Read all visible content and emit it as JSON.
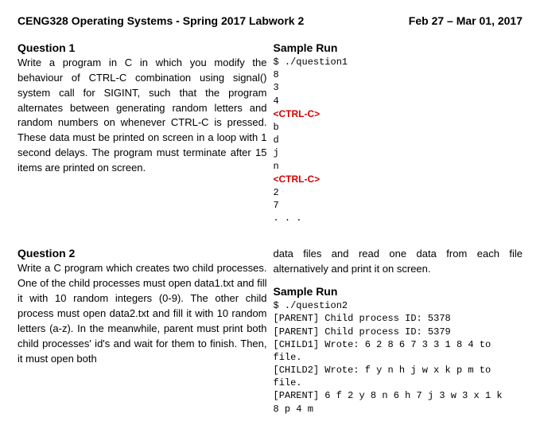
{
  "header": {
    "title": "CENG328 Operating Systems - Spring 2017 Labwork 2",
    "date": "Feb 27 – Mar 01, 2017"
  },
  "q1": {
    "title": "Question 1",
    "text": "Write a program in C in which you modify the behaviour of CTRL-C combination using signal() system call for SIGINT, such that the program alternates between generating random letters and random numbers on whenever CTRL-C is pressed. These data must be printed on screen in a loop with 1 second delays. The program must terminate after 15 items are printed on screen.",
    "sample_title": "Sample Run",
    "run": {
      "cmd": "$ ./question1",
      "l1": "8",
      "l2": "3",
      "l3": "4",
      "ctrl1": "<CTRL-C>",
      "l4": "b",
      "l5": "d",
      "l6": "j",
      "l7": "n",
      "ctrl2": "<CTRL-C>",
      "l8": "2",
      "l9": "7",
      "l10": ". . ."
    }
  },
  "q2": {
    "title": "Question 2",
    "left_text": "Write a C program which creates two child processes. One of the child processes must open data1.txt and fill it with 10 random integers (0-9). The other child process must open data2.txt and fill it with 10 random letters (a-z). In the meanwhile, parent must print both child processes' id's and wait for them to finish. Then, it must open both",
    "right_text": "data files and read one data from each file alternatively and print it on screen.",
    "sample_title": "Sample Run",
    "run": {
      "cmd": "$ ./question2",
      "l1": "[PARENT] Child process ID: 5378",
      "l2": "[PARENT] Child process ID: 5379",
      "l3": "[CHILD1] Wrote: 6 2 8 6 7 3 3 1 8 4 to",
      "l4": "file.",
      "l5": "[CHILD2] Wrote: f y n h j w x k p m to",
      "l6": "file.",
      "l7": "[PARENT] 6 f 2 y 8 n 6 h 7 j 3 w 3 x 1 k",
      "l8": "8 p 4 m"
    }
  }
}
